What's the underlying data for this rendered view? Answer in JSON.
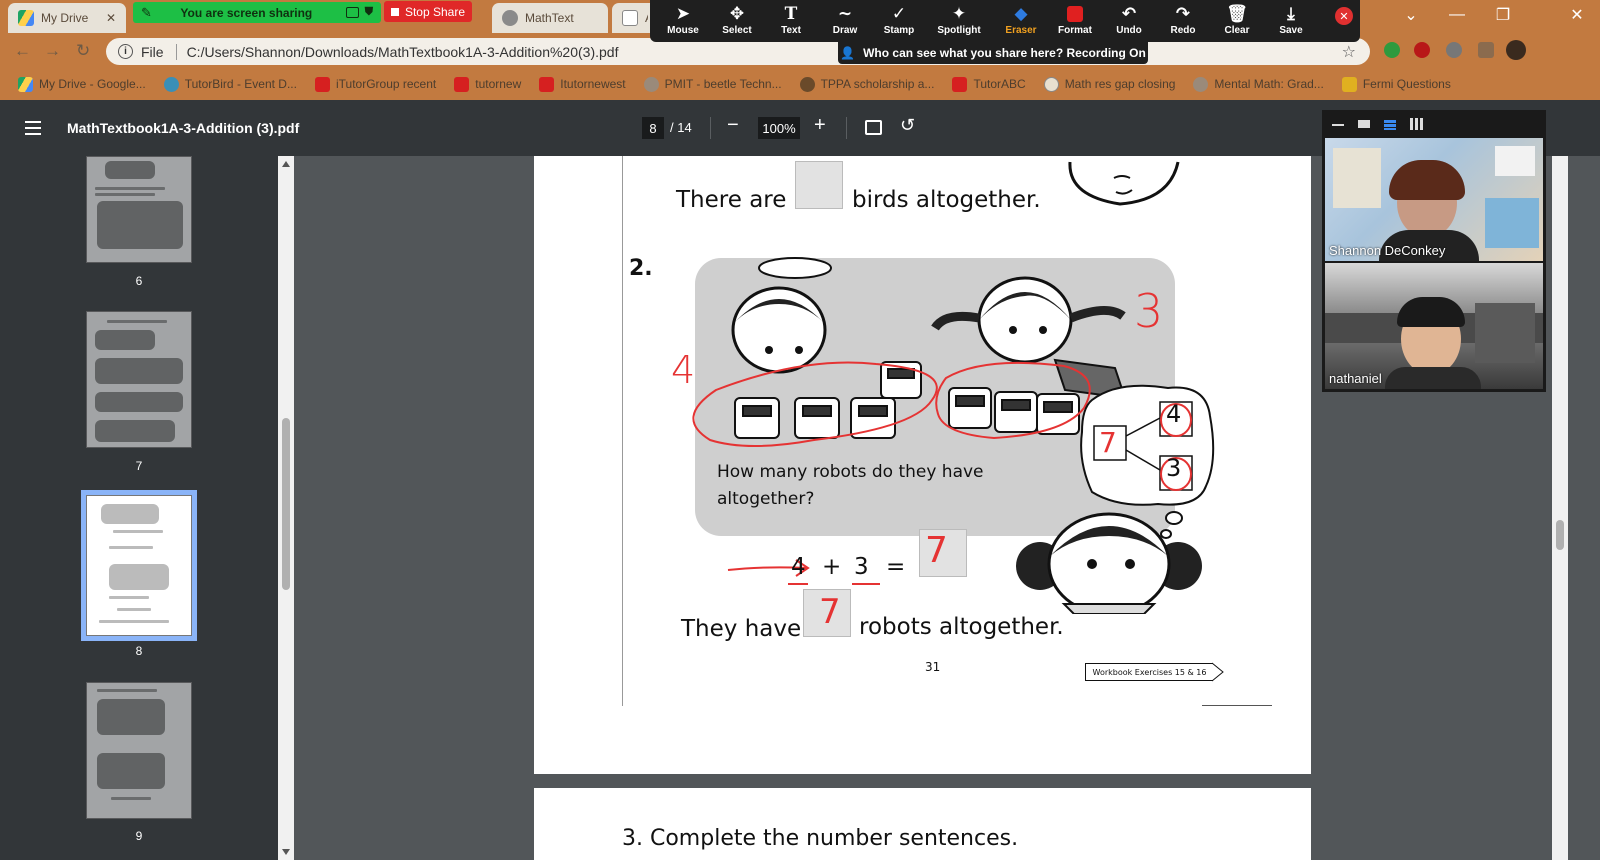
{
  "browser": {
    "tabs": [
      {
        "title": "My Drive"
      },
      {
        "title": "MathText"
      },
      {
        "title": "AN"
      }
    ],
    "share_banner": "You are screen sharing",
    "stop_share": "Stop Share",
    "address": {
      "scheme_label": "File",
      "url": "C:/Users/Shannon/Downloads/MathTextbook1A-3-Addition%20(3).pdf"
    },
    "bookmarks": [
      "My Drive - Google...",
      "TutorBird - Event D...",
      "iTutorGroup recent",
      "tutornew",
      "Itutornewest",
      "PMIT - beetle Techn...",
      "TPPA scholarship a...",
      "TutorABC",
      "Math res gap closing",
      "Mental Math: Grad...",
      "Fermi Questions"
    ]
  },
  "annotation_toolbar": {
    "tools": [
      "Mouse",
      "Select",
      "Text",
      "Draw",
      "Stamp",
      "Spotlight",
      "Eraser",
      "Format",
      "Undo",
      "Redo",
      "Clear",
      "Save"
    ],
    "active_tool": "Eraser",
    "recording_banner": "Who can see what you share here? Recording On"
  },
  "pdf_viewer": {
    "filename": "MathTextbook1A-3-Addition (3).pdf",
    "current_page": "8",
    "total_pages": "/ 14",
    "zoom": "100%",
    "thumbnails": [
      "6",
      "7",
      "8",
      "9"
    ]
  },
  "page_content": {
    "line_prev": {
      "before": "There are",
      "after": "birds altogether."
    },
    "q2_number": "2.",
    "question": [
      "How many robots do they have",
      "altogether?"
    ],
    "equation": {
      "a": "4",
      "plus": "+",
      "b": "3",
      "eq": "=",
      "answer": "7"
    },
    "sentence": {
      "before": "They have",
      "answer": "7",
      "after": "robots altogether."
    },
    "page_number": "31",
    "workbook_tag": "Workbook Exercises 15 & 16",
    "handwritten": {
      "left_count": "4",
      "right_count": "3",
      "bond_whole": "7",
      "bond_top": "4",
      "bond_bottom": "3"
    },
    "next_page_heading": "3.   Complete the number sentences."
  },
  "video_panel": {
    "participants": [
      {
        "name": "Shannon DeConkey"
      },
      {
        "name": "nathaniel"
      }
    ]
  },
  "colors": {
    "browser_frame": "#c27a40",
    "viewer_dark": "#323639",
    "annotation_red": "#e53333",
    "share_green": "#1dbf45",
    "stop_red": "#e02828"
  }
}
